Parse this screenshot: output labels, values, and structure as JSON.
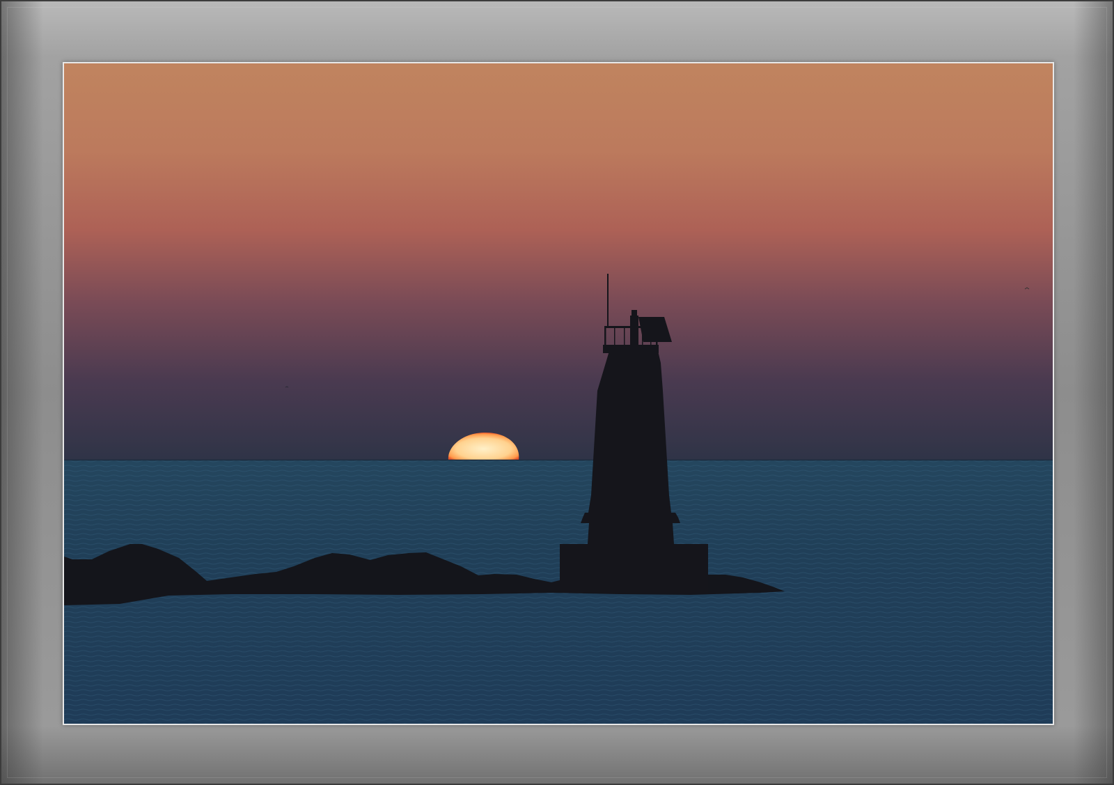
{
  "photo": {
    "subject": "lighthouse-at-sunrise",
    "colors": {
      "frame": "#9a9a9a",
      "mat_edge": "#e8e8e8",
      "sky_top": "#c0845f",
      "sky_mid": "#b06557",
      "sky_low": "#5d3f52",
      "sky_horizon": "#2f3447",
      "sun": "#ffd79a",
      "sun_rim": "#e8542a",
      "sea_top": "#23425a",
      "sea_bottom": "#1e3a55",
      "silhouette": "#14141a"
    }
  }
}
